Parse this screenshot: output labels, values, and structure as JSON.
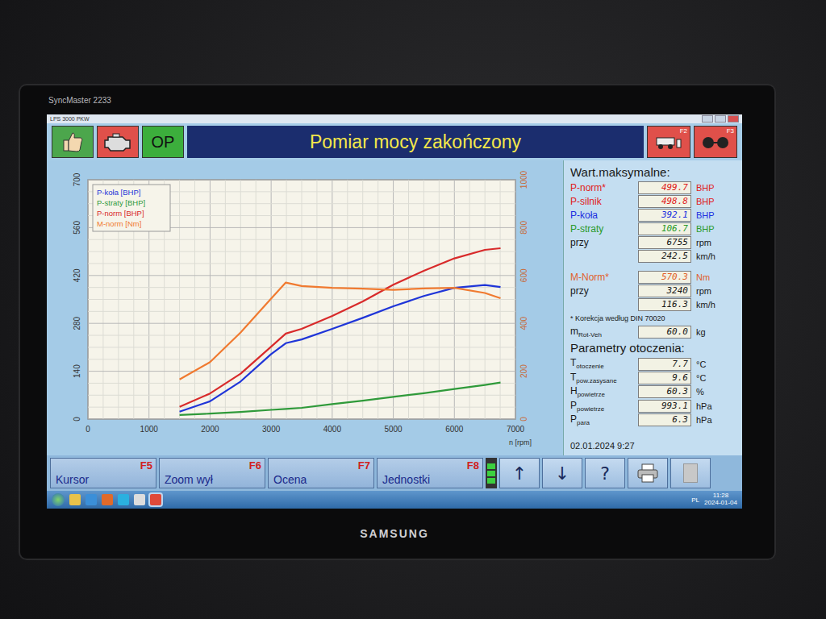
{
  "monitor": {
    "model": "SyncMaster 2233",
    "brand": "SAMSUNG"
  },
  "window": {
    "title": "LPS 3000 PKW"
  },
  "toolbar": {
    "op_label": "OP",
    "title": "Pomiar mocy zakończony",
    "right_keys": [
      "F2",
      "F3"
    ]
  },
  "chart": {
    "y_left_ticks": [
      "0",
      "140",
      "280",
      "420",
      "560",
      "700"
    ],
    "y_right_ticks": [
      "0",
      "200",
      "400",
      "600",
      "800",
      "1000"
    ],
    "x_ticks": [
      "0",
      "1000",
      "2000",
      "3000",
      "4000",
      "5000",
      "6000",
      "7000"
    ],
    "x_label": "n [rpm]",
    "rpm": [
      1500,
      2000,
      2500,
      3000,
      3240,
      3500,
      4000,
      4500,
      5000,
      5500,
      6000,
      6500,
      6755
    ],
    "series": [
      {
        "name": "P-koła [BHP]",
        "color": "#1f35d8",
        "axis": "left",
        "values": [
          22,
          52,
          110,
          190,
          222,
          233,
          264,
          296,
          330,
          360,
          384,
          392.1,
          386
        ]
      },
      {
        "name": "P-straty [BHP]",
        "color": "#2f9a3a",
        "axis": "left",
        "values": [
          12,
          16,
          21,
          27,
          30,
          33,
          44,
          54,
          65,
          76,
          88,
          100,
          106.7
        ]
      },
      {
        "name": "P-norm [BHP]",
        "color": "#d82a2a",
        "axis": "left",
        "values": [
          36,
          75,
          133,
          212,
          250,
          264,
          302,
          344,
          393,
          434,
          470,
          495,
          499.7
        ]
      },
      {
        "name": "M-norm [Nm]",
        "color": "#f07a30",
        "axis": "right",
        "values": [
          166,
          238,
          362,
          503,
          570.3,
          556,
          548,
          545,
          540,
          546,
          548,
          527,
          505
        ]
      }
    ]
  },
  "maxima": {
    "title": "Wart.maksymalne:",
    "rows": [
      {
        "label": "P-norm*",
        "value": "499.7",
        "unit": "BHP",
        "color": "#e02020"
      },
      {
        "label": "P-silnik",
        "value": "498.8",
        "unit": "BHP",
        "color": "#e02020"
      },
      {
        "label": "P-koła",
        "value": "392.1",
        "unit": "BHP",
        "color": "#2030e0"
      },
      {
        "label": "P-straty",
        "value": "106.7",
        "unit": "BHP",
        "color": "#2a9a2a"
      },
      {
        "label": "przy",
        "value": "6755",
        "unit": "rpm",
        "color": "#1a1a1a"
      },
      {
        "label": "",
        "value": "242.5",
        "unit": "km/h",
        "color": "#1a1a1a"
      }
    ],
    "torque_rows": [
      {
        "label": "M-Norm*",
        "value": "570.3",
        "unit": "Nm",
        "color": "#e0602a"
      },
      {
        "label": "przy",
        "value": "3240",
        "unit": "rpm",
        "color": "#1a1a1a"
      },
      {
        "label": "",
        "value": "116.3",
        "unit": "km/h",
        "color": "#1a1a1a"
      }
    ],
    "note": "* Korekcja według DIN 70020",
    "mass": {
      "label": "m",
      "sub": "Rot-Veh",
      "value": "60.0",
      "unit": "kg"
    }
  },
  "environment": {
    "title": "Parametry otoczenia:",
    "rows": [
      {
        "label": "T",
        "sub": "otoczenie",
        "value": "7.7",
        "unit": "°C"
      },
      {
        "label": "T",
        "sub": "pow.zasysane",
        "value": "9.6",
        "unit": "°C"
      },
      {
        "label": "H",
        "sub": "powietrze",
        "value": "60.3",
        "unit": "%"
      },
      {
        "label": "P",
        "sub": "powietrze",
        "value": "993.1",
        "unit": "hPa"
      },
      {
        "label": "P",
        "sub": "para",
        "value": "6.3",
        "unit": "hPa"
      }
    ]
  },
  "timestamp": "02.01.2024 9:27",
  "function_keys": [
    {
      "label": "Kursor",
      "key": "F5"
    },
    {
      "label": "Zoom wył",
      "key": "F6"
    },
    {
      "label": "Ocena",
      "key": "F7"
    },
    {
      "label": "Jednostki",
      "key": "F8"
    }
  ],
  "tool_buttons": [
    {
      "kind": "glyph",
      "glyph": "↑"
    },
    {
      "kind": "glyph",
      "glyph": "↓"
    },
    {
      "kind": "glyph",
      "glyph": "?"
    },
    {
      "kind": "printer",
      "glyph": ""
    },
    {
      "kind": "blank",
      "glyph": ""
    }
  ],
  "taskbar": {
    "lang": "PL",
    "time": "11:28",
    "date": "2024-01-04"
  }
}
